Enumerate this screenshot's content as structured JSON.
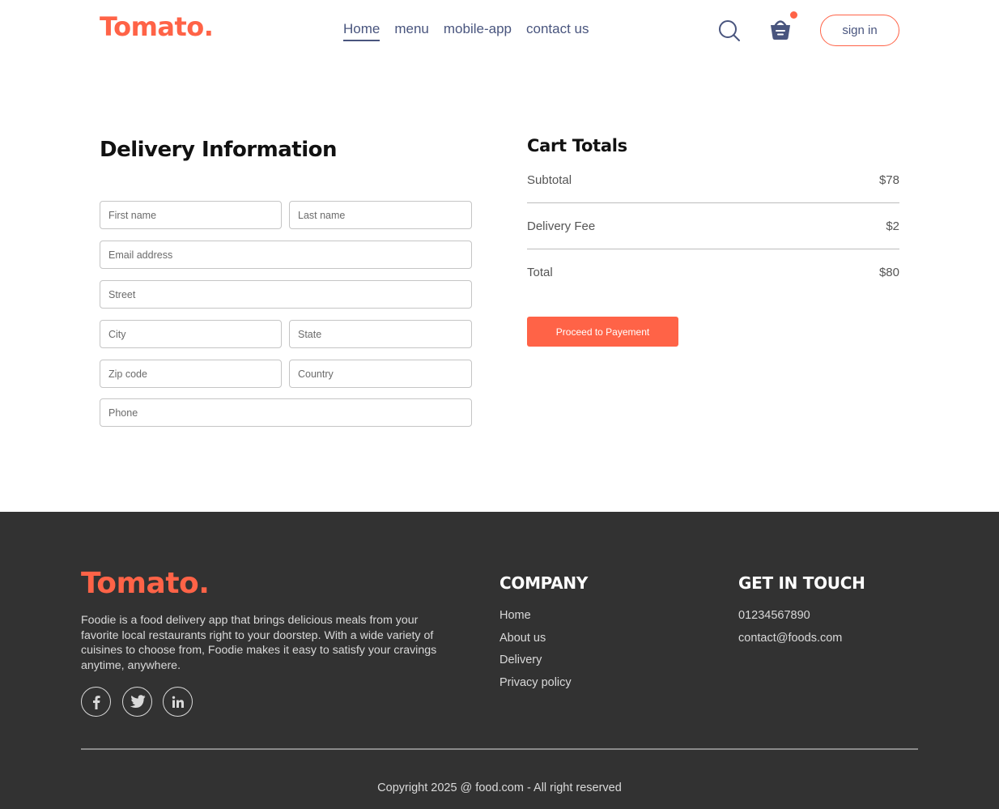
{
  "navbar": {
    "logo": "Tomato.",
    "menu": [
      "Home",
      "menu",
      "mobile-app",
      "contact us"
    ],
    "active_item": "Home",
    "search_icon": "search-icon",
    "basket_icon": "basket-icon",
    "cart_has_items": true,
    "signin_label": "sign in"
  },
  "delivery": {
    "title": "Delivery Information",
    "first_name_placeholder": "First name",
    "last_name_placeholder": "Last name",
    "email_placeholder": "Email address",
    "street_placeholder": "Street",
    "city_placeholder": "City",
    "state_placeholder": "State",
    "zip_placeholder": "Zip code",
    "country_placeholder": "Country",
    "phone_placeholder": "Phone"
  },
  "cart_totals": {
    "title": "Cart Totals",
    "subtotal_label": "Subtotal",
    "subtotal_value": "$78",
    "delivery_fee_label": "Delivery Fee",
    "delivery_fee_value": "$2",
    "total_label": "Total",
    "total_value": "$80",
    "proceed_label": "Proceed to Payement"
  },
  "footer": {
    "logo": "Tomato.",
    "description": "Foodie is a food delivery app that brings delicious meals from your favorite local restaurants right to your doorstep. With a wide variety of cuisines to choose from, Foodie makes it easy to satisfy your cravings anytime, anywhere.",
    "social_icons": [
      "facebook-icon",
      "twitter-icon",
      "linkedin-icon"
    ],
    "company_heading": "COMPANY",
    "company_links": [
      "Home",
      "About us",
      "Delivery",
      "Privacy policy"
    ],
    "contact_heading": "GET IN TOUCH",
    "phone": "01234567890",
    "email": "contact@foods.com",
    "copyright": "Copyright 2025 @ food.com - All right reserved"
  },
  "colors": {
    "accent": "#ff6347",
    "nav_text": "#49557e",
    "footer_bg": "#323232",
    "footer_text": "#d9d9d9"
  }
}
